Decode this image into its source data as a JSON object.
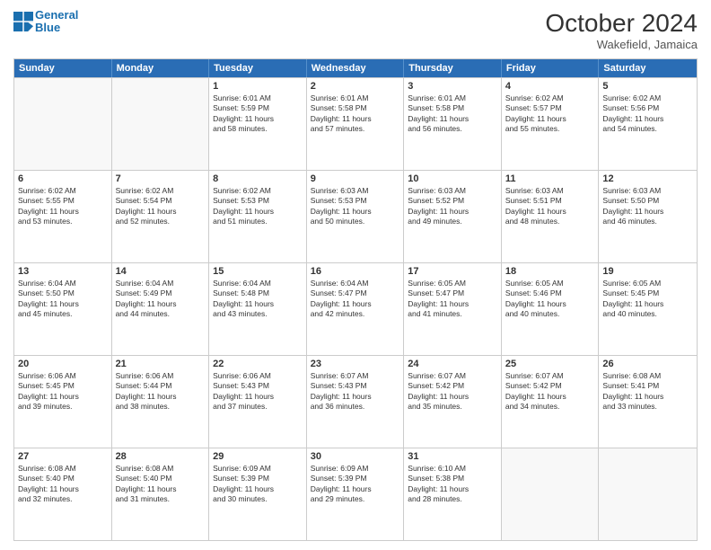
{
  "header": {
    "logo_line1": "General",
    "logo_line2": "Blue",
    "month": "October 2024",
    "location": "Wakefield, Jamaica"
  },
  "weekdays": [
    "Sunday",
    "Monday",
    "Tuesday",
    "Wednesday",
    "Thursday",
    "Friday",
    "Saturday"
  ],
  "rows": [
    [
      {
        "day": "",
        "info": "",
        "empty": true
      },
      {
        "day": "",
        "info": "",
        "empty": true
      },
      {
        "day": "1",
        "info": "Sunrise: 6:01 AM\nSunset: 5:59 PM\nDaylight: 11 hours\nand 58 minutes."
      },
      {
        "day": "2",
        "info": "Sunrise: 6:01 AM\nSunset: 5:58 PM\nDaylight: 11 hours\nand 57 minutes."
      },
      {
        "day": "3",
        "info": "Sunrise: 6:01 AM\nSunset: 5:58 PM\nDaylight: 11 hours\nand 56 minutes."
      },
      {
        "day": "4",
        "info": "Sunrise: 6:02 AM\nSunset: 5:57 PM\nDaylight: 11 hours\nand 55 minutes."
      },
      {
        "day": "5",
        "info": "Sunrise: 6:02 AM\nSunset: 5:56 PM\nDaylight: 11 hours\nand 54 minutes."
      }
    ],
    [
      {
        "day": "6",
        "info": "Sunrise: 6:02 AM\nSunset: 5:55 PM\nDaylight: 11 hours\nand 53 minutes."
      },
      {
        "day": "7",
        "info": "Sunrise: 6:02 AM\nSunset: 5:54 PM\nDaylight: 11 hours\nand 52 minutes."
      },
      {
        "day": "8",
        "info": "Sunrise: 6:02 AM\nSunset: 5:53 PM\nDaylight: 11 hours\nand 51 minutes."
      },
      {
        "day": "9",
        "info": "Sunrise: 6:03 AM\nSunset: 5:53 PM\nDaylight: 11 hours\nand 50 minutes."
      },
      {
        "day": "10",
        "info": "Sunrise: 6:03 AM\nSunset: 5:52 PM\nDaylight: 11 hours\nand 49 minutes."
      },
      {
        "day": "11",
        "info": "Sunrise: 6:03 AM\nSunset: 5:51 PM\nDaylight: 11 hours\nand 48 minutes."
      },
      {
        "day": "12",
        "info": "Sunrise: 6:03 AM\nSunset: 5:50 PM\nDaylight: 11 hours\nand 46 minutes."
      }
    ],
    [
      {
        "day": "13",
        "info": "Sunrise: 6:04 AM\nSunset: 5:50 PM\nDaylight: 11 hours\nand 45 minutes."
      },
      {
        "day": "14",
        "info": "Sunrise: 6:04 AM\nSunset: 5:49 PM\nDaylight: 11 hours\nand 44 minutes."
      },
      {
        "day": "15",
        "info": "Sunrise: 6:04 AM\nSunset: 5:48 PM\nDaylight: 11 hours\nand 43 minutes."
      },
      {
        "day": "16",
        "info": "Sunrise: 6:04 AM\nSunset: 5:47 PM\nDaylight: 11 hours\nand 42 minutes."
      },
      {
        "day": "17",
        "info": "Sunrise: 6:05 AM\nSunset: 5:47 PM\nDaylight: 11 hours\nand 41 minutes."
      },
      {
        "day": "18",
        "info": "Sunrise: 6:05 AM\nSunset: 5:46 PM\nDaylight: 11 hours\nand 40 minutes."
      },
      {
        "day": "19",
        "info": "Sunrise: 6:05 AM\nSunset: 5:45 PM\nDaylight: 11 hours\nand 40 minutes."
      }
    ],
    [
      {
        "day": "20",
        "info": "Sunrise: 6:06 AM\nSunset: 5:45 PM\nDaylight: 11 hours\nand 39 minutes."
      },
      {
        "day": "21",
        "info": "Sunrise: 6:06 AM\nSunset: 5:44 PM\nDaylight: 11 hours\nand 38 minutes."
      },
      {
        "day": "22",
        "info": "Sunrise: 6:06 AM\nSunset: 5:43 PM\nDaylight: 11 hours\nand 37 minutes."
      },
      {
        "day": "23",
        "info": "Sunrise: 6:07 AM\nSunset: 5:43 PM\nDaylight: 11 hours\nand 36 minutes."
      },
      {
        "day": "24",
        "info": "Sunrise: 6:07 AM\nSunset: 5:42 PM\nDaylight: 11 hours\nand 35 minutes."
      },
      {
        "day": "25",
        "info": "Sunrise: 6:07 AM\nSunset: 5:42 PM\nDaylight: 11 hours\nand 34 minutes."
      },
      {
        "day": "26",
        "info": "Sunrise: 6:08 AM\nSunset: 5:41 PM\nDaylight: 11 hours\nand 33 minutes."
      }
    ],
    [
      {
        "day": "27",
        "info": "Sunrise: 6:08 AM\nSunset: 5:40 PM\nDaylight: 11 hours\nand 32 minutes."
      },
      {
        "day": "28",
        "info": "Sunrise: 6:08 AM\nSunset: 5:40 PM\nDaylight: 11 hours\nand 31 minutes."
      },
      {
        "day": "29",
        "info": "Sunrise: 6:09 AM\nSunset: 5:39 PM\nDaylight: 11 hours\nand 30 minutes."
      },
      {
        "day": "30",
        "info": "Sunrise: 6:09 AM\nSunset: 5:39 PM\nDaylight: 11 hours\nand 29 minutes."
      },
      {
        "day": "31",
        "info": "Sunrise: 6:10 AM\nSunset: 5:38 PM\nDaylight: 11 hours\nand 28 minutes."
      },
      {
        "day": "",
        "info": "",
        "empty": true
      },
      {
        "day": "",
        "info": "",
        "empty": true
      }
    ]
  ]
}
